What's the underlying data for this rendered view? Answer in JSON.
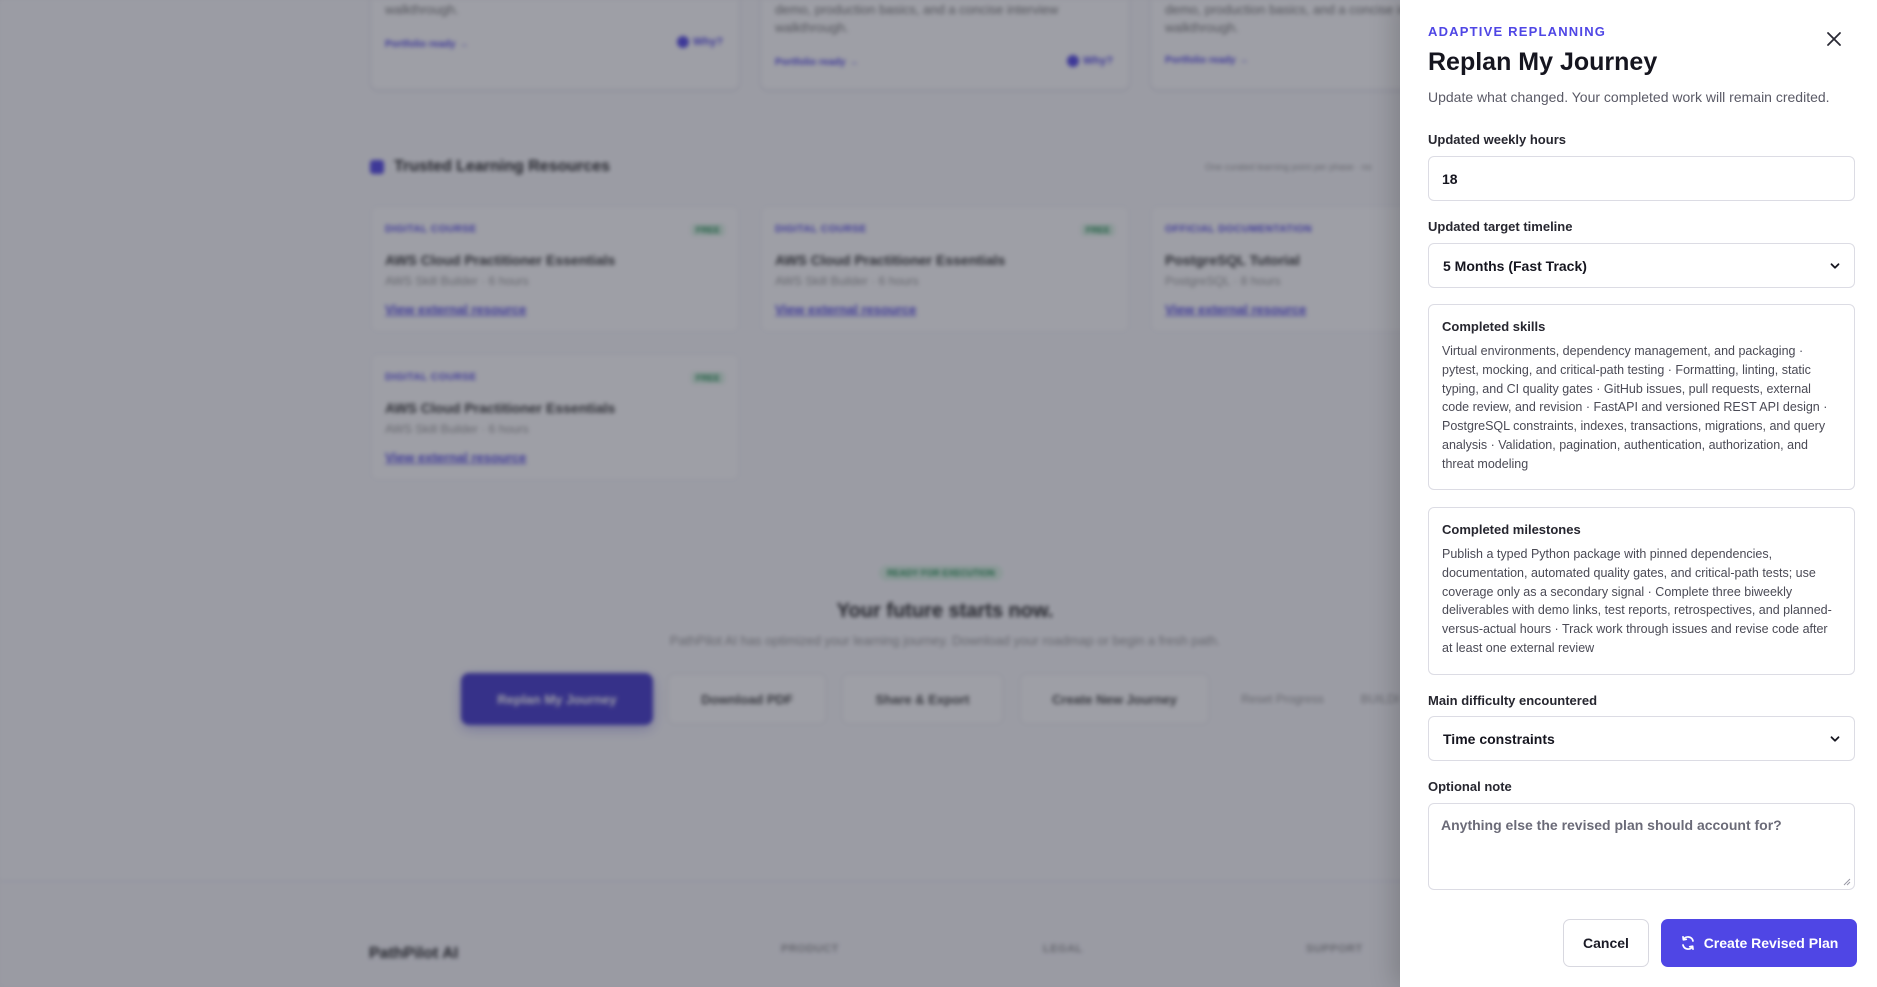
{
  "background": {
    "top_cards": [
      {
        "desc": "walkthrough.",
        "link": "Portfolio ready →",
        "why": "Why?"
      },
      {
        "desc": "demo, production basics, and a concise interview walkthrough.",
        "link": "Portfolio ready →",
        "why": "Why?"
      },
      {
        "desc": "demo, production basics, and a concise interview walkthrough.",
        "link": "Portfolio ready →",
        "why": ""
      }
    ],
    "resources_title": "Trusted Learning Resources",
    "resources_hint": "One curated learning point per phase · no",
    "resources": [
      {
        "kind": "DIGITAL COURSE",
        "tag": "FREE",
        "title": "AWS Cloud Practitioner Essentials",
        "source": "AWS Skill Builder · 6 hours",
        "link": "View external resource"
      },
      {
        "kind": "DIGITAL COURSE",
        "tag": "FREE",
        "title": "AWS Cloud Practitioner Essentials",
        "source": "AWS Skill Builder · 6 hours",
        "link": "View external resource"
      },
      {
        "kind": "OFFICIAL DOCUMENTATION",
        "tag": "",
        "title": "PostgreSQL Tutorial",
        "source": "PostgreSQL · 8 hours",
        "link": "View external resource"
      },
      {
        "kind": "DIGITAL COURSE",
        "tag": "FREE",
        "title": "AWS Cloud Practitioner Essentials",
        "source": "AWS Skill Builder · 6 hours",
        "link": "View external resource"
      }
    ],
    "cta": {
      "badge": "READY FOR EXECUTION",
      "title": "Your future starts now.",
      "subtitle": "PathPilot AI has optimized your learning journey. Download your roadmap or begin a fresh path.",
      "buttons": [
        "Replan My Journey",
        "Download PDF",
        "Share & Export",
        "Create New Journey",
        "Reset Progress",
        "BUILDI"
      ]
    },
    "footer": {
      "brand": "PathPilot AI",
      "columns": [
        "PRODUCT",
        "LEGAL",
        "SUPPORT"
      ]
    }
  },
  "drawer": {
    "eyebrow": "ADAPTIVE REPLANNING",
    "title": "Replan My Journey",
    "subtitle": "Update what changed. Your completed work will remain credited.",
    "weekly_hours_label": "Updated weekly hours",
    "weekly_hours_value": "18",
    "timeline_label": "Updated target timeline",
    "timeline_value": "5 Months (Fast Track)",
    "completed_skills_title": "Completed skills",
    "completed_skills_text": "Virtual environments, dependency management, and packaging · pytest, mocking, and critical-path testing · Formatting, linting, static typing, and CI quality gates · GitHub issues, pull requests, external code review, and revision · FastAPI and versioned REST API design · PostgreSQL constraints, indexes, transactions, migrations, and query analysis · Validation, pagination, authentication, authorization, and threat modeling",
    "completed_milestones_title": "Completed milestones",
    "completed_milestones_text": "Publish a typed Python package with pinned dependencies, documentation, automated quality gates, and critical-path tests; use coverage only as a secondary signal · Complete three biweekly deliverables with demo links, test reports, retrospectives, and planned-versus-actual hours · Track work through issues and revise code after at least one external review",
    "difficulty_label": "Main difficulty encountered",
    "difficulty_value": "Time constraints",
    "note_label": "Optional note",
    "note_placeholder": "Anything else the revised plan should account for?",
    "cancel_label": "Cancel",
    "submit_label": "Create Revised Plan"
  },
  "colors": {
    "accent": "#4f46e5",
    "overlay": "#282a3a"
  }
}
